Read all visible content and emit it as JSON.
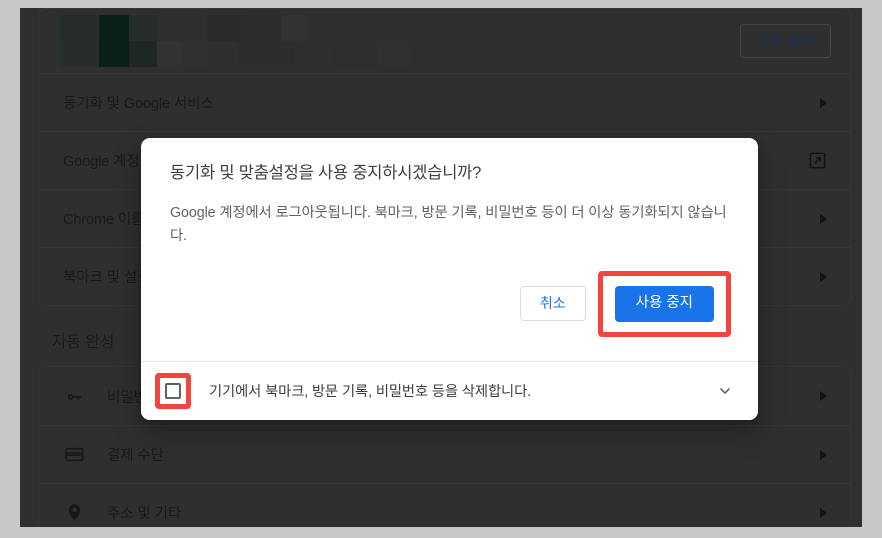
{
  "page": {
    "account_row": {
      "redacted": true,
      "turn_off_label": "사용 중지"
    },
    "sync_card_rows": [
      {
        "label": "동기화 및 Google 서비스",
        "trailing": "arrow-right-icon"
      },
      {
        "label": "Google 계정",
        "trailing": "external-link-icon"
      },
      {
        "label": "Chrome 이름 및 사진",
        "trailing": "arrow-right-icon"
      },
      {
        "label": "북마크 및 설정 가져오기",
        "trailing": "arrow-right-icon"
      }
    ],
    "autofill_section": {
      "heading": "자동 완성",
      "rows": [
        {
          "icon": "key-icon",
          "label": "비밀번호",
          "trailing": "arrow-right-icon"
        },
        {
          "icon": "credit-card-icon",
          "label": "결제 수단",
          "trailing": "arrow-right-icon"
        },
        {
          "icon": "location-pin-icon",
          "label": "주소 및 기타",
          "trailing": "arrow-right-icon"
        }
      ]
    }
  },
  "dialog": {
    "title": "동기화 및 맞춤설정을 사용 중지하시겠습니까?",
    "body": "Google 계정에서 로그아웃됩니다. 북마크, 방문 기록, 비밀번호 등이 더 이상 동기화되지 않습니다.",
    "cancel_label": "취소",
    "confirm_label": "사용 중지",
    "footer_label": "기기에서 북마크, 방문 기록, 비밀번호 등을 삭제합니다.",
    "footer_checkbox_checked": false,
    "footer_expand_icon": "chevron-down-icon"
  },
  "annotations": {
    "highlight_color": "#f4443f",
    "targets": [
      "confirm-button",
      "delete-data-checkbox"
    ]
  },
  "colors": {
    "primary_button": "#1a73e8",
    "link_text": "#1a73e8",
    "scrim": "rgba(0,0,0,0.50)",
    "dialog_background": "#ffffff",
    "frame": "#c6c8ca"
  }
}
